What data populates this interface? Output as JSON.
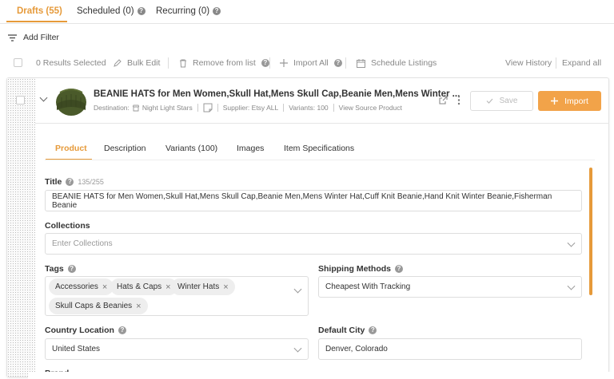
{
  "tabs": [
    {
      "label": "Drafts (55)",
      "active": true
    },
    {
      "label": "Scheduled (0)",
      "help": true
    },
    {
      "label": "Recurring (0)",
      "help": true
    }
  ],
  "add_filter": "Add Filter",
  "toolbar": {
    "selected": "0 Results Selected",
    "bulk_edit": "Bulk Edit",
    "remove": "Remove from list",
    "import_all": "Import All",
    "schedule": "Schedule Listings",
    "view_history": "View History",
    "expand_all": "Expand all"
  },
  "product": {
    "title": "BEANIE HATS for Men Women,Skull Hat,Mens Skull Cap,Beanie Men,Mens Winter ...",
    "destination_label": "Destination:",
    "destination": "Night Light Stars",
    "supplier": "Supplier: Etsy ALL",
    "variants": "Variants: 100",
    "view_source": "View Source Product",
    "save_label": "Save",
    "import_label": "Import"
  },
  "product_tabs": [
    "Product",
    "Description",
    "Variants (100)",
    "Images",
    "Item Specifications"
  ],
  "form": {
    "title_label": "Title",
    "title_count": "135/255",
    "title_value": "BEANIE HATS for Men Women,Skull Hat,Mens Skull Cap,Beanie Men,Mens Winter Hat,Cuff Knit Beanie,Hand Knit Winter Beanie,Fisherman Beanie",
    "collections_label": "Collections",
    "collections_placeholder": "Enter Collections",
    "tags_label": "Tags",
    "tags": [
      "Accessories",
      "Hats & Caps",
      "Winter Hats",
      "Skull Caps & Beanies"
    ],
    "shipping_label": "Shipping Methods",
    "shipping_value": "Cheapest With Tracking",
    "country_label": "Country Location",
    "country_value": "United States",
    "city_label": "Default City",
    "city_value": "Denver, Colorado",
    "brand_label": "Brand"
  },
  "colors": {
    "accent": "#e69a3a"
  }
}
